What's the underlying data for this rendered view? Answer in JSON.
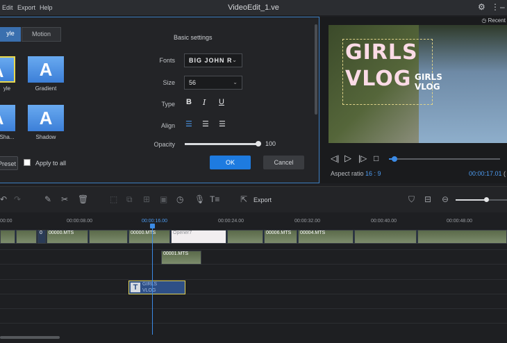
{
  "menu": [
    "Edit",
    "Export",
    "Help"
  ],
  "window": {
    "title": "VideoEdit_1.ve"
  },
  "dialog": {
    "tabs": [
      "yle",
      "Motion"
    ],
    "section_title": "Basic settings",
    "styles": [
      {
        "label": "yle",
        "glyph": "A"
      },
      {
        "label": "Gradient",
        "glyph": "A"
      },
      {
        "label": "Sha...",
        "glyph": "A"
      },
      {
        "label": "Shadow",
        "glyph": "A"
      }
    ],
    "fonts_label": "Fonts",
    "font_value": "BIG JOHN R",
    "size_label": "Size",
    "size_value": "56",
    "type_label": "Type",
    "type_buttons": [
      "B",
      "I",
      "U"
    ],
    "align_label": "Align",
    "opacity_label": "Opacity",
    "opacity_value": "100",
    "preset_label": "Preset",
    "apply_all_label": "Apply to all",
    "ok_label": "OK",
    "cancel_label": "Cancel",
    "ok_color": "#1e7be0"
  },
  "preview": {
    "recent_label": "Recent",
    "title_line1": "GIRLS",
    "title_line2": "VLOG",
    "small_line1": "GIRLS",
    "small_line2": "VLOG",
    "aspect_label": "Aspect ratio",
    "aspect_value": "16 : 9",
    "timecode": "00:00:17.01",
    "timecode_tail": "(",
    "progress": 0.05
  },
  "toolbar": {
    "export_label": "Export",
    "zoom_level": 0.6
  },
  "timeline": {
    "ticks": [
      "00:00",
      "00:00:08.00",
      "00:00:16.00",
      "00:00:24.00",
      "00:00:32.00",
      "00:00:40.00",
      "00:00:48.00"
    ],
    "playhead_label": "00:00:16.00",
    "main_clips": [
      "",
      "",
      "0",
      "00000.MTS",
      "",
      "00000.MTS",
      "Opener7",
      "",
      "00006.MTS",
      "00004.MTS",
      "",
      ""
    ],
    "overlay_clip": "00001.MTS",
    "text_clip_line1": "GIRLS",
    "text_clip_line2": "VLOG"
  }
}
